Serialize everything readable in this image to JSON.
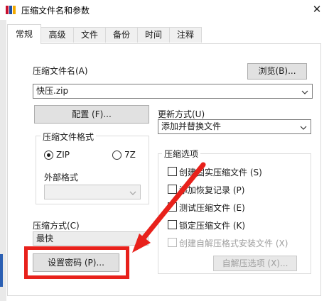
{
  "window": {
    "title": "压缩文件名和参数",
    "close_glyph": "✕"
  },
  "tabs": [
    {
      "label": "常规",
      "active": true
    },
    {
      "label": "高级"
    },
    {
      "label": "文件"
    },
    {
      "label": "备份"
    },
    {
      "label": "时间"
    },
    {
      "label": "注释"
    }
  ],
  "archive": {
    "name_label": "压缩文件名(A)",
    "browse_label": "浏览(B)...",
    "name_value": "快压.zip",
    "profiles_label": "配置 (F)..."
  },
  "update": {
    "label": "更新方式(U)",
    "value": "添加并替换文件"
  },
  "format": {
    "group_title": "压缩文件格式",
    "zip_label": "ZIP",
    "sevenz_label": "7Z",
    "selected": "ZIP",
    "external_label": "外部格式",
    "external_value": ""
  },
  "options": {
    "group_title": "压缩选项",
    "items": [
      {
        "label": "创建固实压缩文件 (S)",
        "checked": false,
        "enabled": true
      },
      {
        "label": "添加恢复记录 (P)",
        "checked": false,
        "enabled": true
      },
      {
        "label": "测试压缩文件 (E)",
        "checked": false,
        "enabled": true
      },
      {
        "label": "锁定压缩文件 (K)",
        "checked": false,
        "enabled": true
      },
      {
        "label": "创建自解压格式安装文件 (X)",
        "checked": false,
        "enabled": false
      }
    ],
    "sfx_button_label": "自解压选项 (X)..."
  },
  "method": {
    "label": "压缩方式(C)",
    "value": "最快"
  },
  "password": {
    "button_label": "设置密码 (P)..."
  },
  "colors": {
    "highlight_red": "#e8211b",
    "accent_blue": "#2b5fb3"
  }
}
